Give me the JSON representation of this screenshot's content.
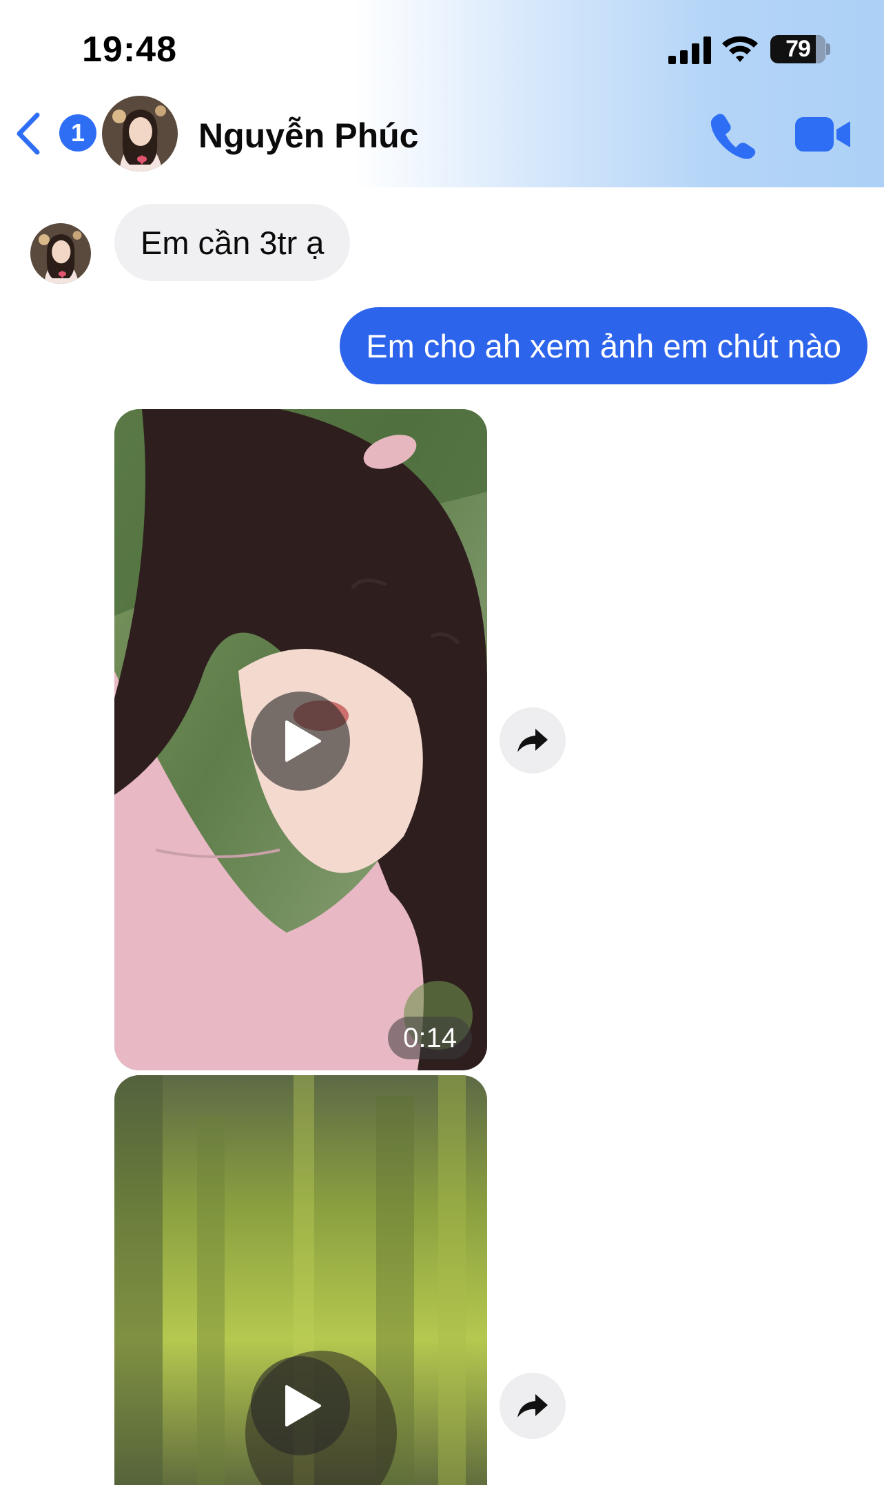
{
  "status_bar": {
    "time": "19:48",
    "signal_icon": "cellular-signal-icon",
    "wifi_icon": "wifi-icon",
    "battery_level": "79"
  },
  "nav": {
    "back_icon": "chevron-left-icon",
    "unread_count": "1",
    "contact_name": "Nguyễn Phúc",
    "call_icon": "phone-icon",
    "video_call_icon": "video-camera-icon",
    "accent_color": "#2d6ef5"
  },
  "messages": [
    {
      "direction": "incoming",
      "type": "text",
      "text": "Em cần 3tr ạ"
    },
    {
      "direction": "outgoing",
      "type": "text",
      "text": "Em cho ah xem ảnh em chút nào"
    },
    {
      "direction": "incoming",
      "type": "video",
      "duration": "0:14",
      "play_icon": "play-icon",
      "share_icon": "share-arrow-icon"
    },
    {
      "direction": "incoming",
      "type": "video",
      "duration": "",
      "play_icon": "play-icon",
      "share_icon": "share-arrow-icon"
    }
  ],
  "colors": {
    "outgoing_bubble": "#2d64ec",
    "incoming_bubble": "#f0f0f2"
  }
}
